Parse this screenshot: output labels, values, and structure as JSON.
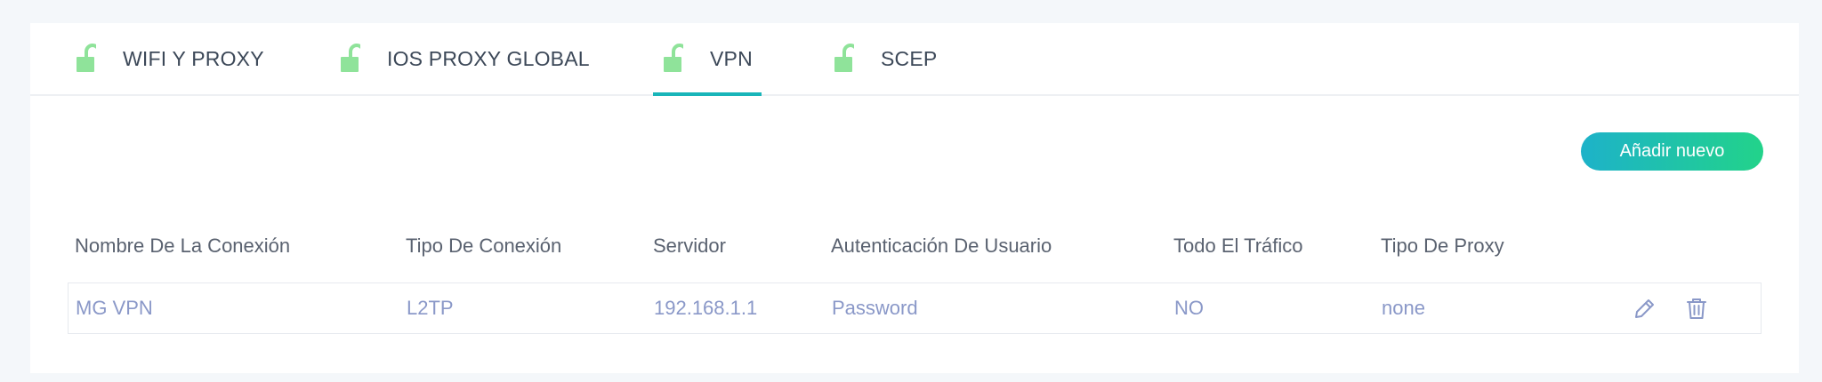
{
  "tabs": [
    {
      "label": "WIFI Y PROXY",
      "icon": "unlock-icon"
    },
    {
      "label": "IOS PROXY GLOBAL",
      "icon": "unlock-icon"
    },
    {
      "label": "VPN",
      "icon": "unlock-icon",
      "active": true
    },
    {
      "label": "SCEP",
      "icon": "unlock-icon"
    }
  ],
  "add_button": {
    "label": "Añadir nuevo"
  },
  "table": {
    "headers": [
      "Nombre De La Conexión",
      "Tipo De Conexión",
      "Servidor",
      "Autenticación De Usuario",
      "Todo El Tráfico",
      "Tipo De Proxy"
    ],
    "rows": [
      {
        "name": "MG VPN",
        "type": "L2TP",
        "server": "192.168.1.1",
        "auth": "Password",
        "all_traffic": "NO",
        "proxy_type": "none",
        "actions": [
          "edit-icon",
          "trash-icon"
        ]
      }
    ]
  },
  "colors": {
    "accent": "#19b5b9",
    "button_gradient_start": "#1db2c9",
    "button_gradient_end": "#22d38a",
    "lock_icon": "#8fe39a",
    "row_text": "#8a98c8",
    "header_text": "#5a6270"
  }
}
